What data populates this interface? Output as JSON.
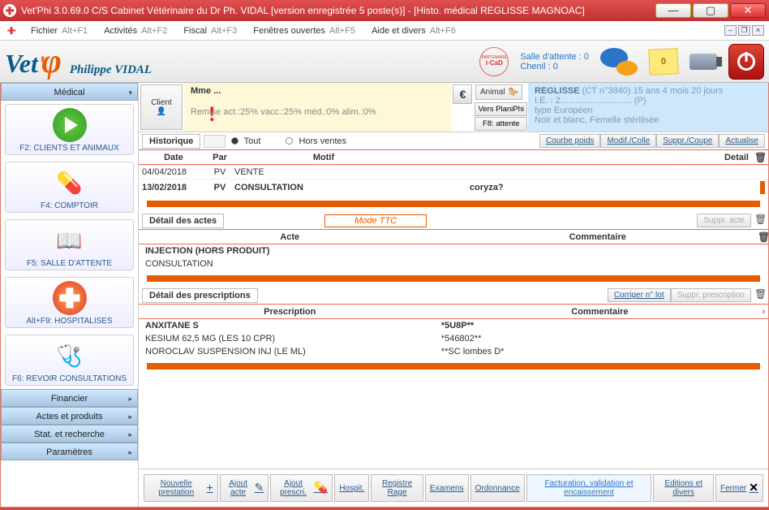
{
  "window": {
    "title": "Vet'Phi 3.0.69.0 C/S  Cabinet Vétérinaire du Dr Ph. VIDAL  [version enregistrée 5 poste(s)] - [Histo. médical REGLISSE MAGNOAC]"
  },
  "menubar": {
    "items": [
      {
        "label": "Fichier",
        "shortcut": "Alt+F1"
      },
      {
        "label": "Activités",
        "shortcut": "Alt+F2"
      },
      {
        "label": "Fiscal",
        "shortcut": "Alt+F3"
      },
      {
        "label": "Fenêtres ouvertes",
        "shortcut": "Alt+F5"
      },
      {
        "label": "Aide et divers",
        "shortcut": "Alt+F6"
      }
    ]
  },
  "toolbar": {
    "username": "Philippe VIDAL",
    "logo_vet": "Vet",
    "logo_apos": "'",
    "waiting_room": "Salle d'attente : 0",
    "kennel": "Chenil : 0",
    "icad_top": "PARTENAIRE",
    "icad_bot": "i·CaD",
    "sticky_count": "0"
  },
  "sidebar": {
    "sections": [
      {
        "title": "Médical",
        "expanded": true
      },
      {
        "title": "Financier",
        "expanded": false
      },
      {
        "title": "Actes et produits",
        "expanded": false
      },
      {
        "title": "Stat. et recherche",
        "expanded": false
      },
      {
        "title": "Paramètres",
        "expanded": false
      }
    ],
    "buttons": [
      {
        "label": "F2: CLIENTS ET ANIMAUX"
      },
      {
        "label": "F4: COMPTOIR"
      },
      {
        "label": "F5: SALLE D'ATTENTE"
      },
      {
        "label": "Alt+F9: HOSPITALISES"
      },
      {
        "label": "F6: REVOIR CONSULTATIONS"
      }
    ]
  },
  "infoRow": {
    "client_btn": "Client",
    "client_name": "Mme ...",
    "discount": "Remise act.:25% vacc.:25% méd.:0% alim.:0%",
    "euro": "€",
    "animal_btn": "Animal",
    "sub_btns": {
      "plan": "Vers PlaniPhi",
      "f8": "F8: attente"
    },
    "animal_line1_name": "REGLISSE",
    "animal_line1_rest": " (CT n°3840) 15 ans 4 mois 20 jours",
    "animal_line2": "I.E. : 2…………………… (P)",
    "animal_line3": "type Européen",
    "animal_line4": "Noir et blanc, Femelle stérilisée"
  },
  "history": {
    "label": "Historique",
    "radio1": "Tout",
    "radio2": "Hors ventes",
    "btns": {
      "courbe": "Courbe poids",
      "modif": "Modif./Colle",
      "suppr": "Suppr./Coupe",
      "act": "Actualise"
    },
    "cols": {
      "date": "Date",
      "par": "Par",
      "motif": "Motif",
      "detail": "Detail"
    },
    "rows": [
      {
        "date": "04/04/2018",
        "par": "PV",
        "motif": "VENTE",
        "detail": ""
      },
      {
        "date": "13/02/2018",
        "par": "PV",
        "motif": "CONSULTATION",
        "detail": "coryza?"
      }
    ]
  },
  "acts": {
    "label": "Détail des actes",
    "mode": "Mode TTC",
    "btns": {
      "suppr": "Suppr. acte"
    },
    "cols": {
      "acte": "Acte",
      "comm": "Commentaire"
    },
    "rows": [
      {
        "acte": "INJECTION (HORS PRODUIT)",
        "comm": ""
      },
      {
        "acte": "CONSULTATION",
        "comm": ""
      }
    ]
  },
  "presc": {
    "label": "Détail des prescriptions",
    "btns": {
      "corriger": "Corriger n° lot",
      "suppr": "Suppr. prescription"
    },
    "cols": {
      "presc": "Prescription",
      "comm": "Commentaire"
    },
    "rows": [
      {
        "name": "ANXITANE S",
        "comm": "*5U8P**",
        "head": true
      },
      {
        "name": "KESIUM 62,5 MG (LES 10 CPR)",
        "comm": "*546802**"
      },
      {
        "name": "NOROCLAV SUSPENSION INJ (LE ML)",
        "comm": "**SC  lombes D*"
      }
    ]
  },
  "bottom": {
    "btns": [
      {
        "label": "Nouvelle prestation",
        "icon": "+"
      },
      {
        "label": "Ajout acte",
        "icon": "✎"
      },
      {
        "label": "Ajout prescri.",
        "icon": "💊"
      },
      {
        "label": "Hospit.",
        "icon": ""
      },
      {
        "label": "Registre Rage",
        "icon": ""
      },
      {
        "label": "Examens",
        "icon": ""
      },
      {
        "label": "Ordonnance",
        "icon": ""
      },
      {
        "label": "Facturation, validation et encaissement",
        "icon": "",
        "highlight": true
      },
      {
        "label": "Editions et divers",
        "icon": ""
      },
      {
        "label": "Fermer",
        "icon": "✕"
      }
    ]
  }
}
